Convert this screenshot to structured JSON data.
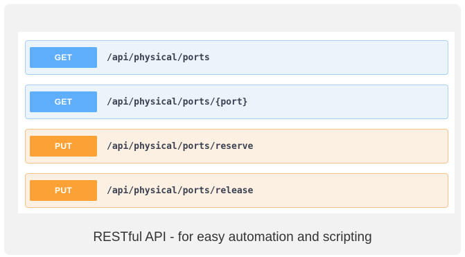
{
  "endpoints": [
    {
      "method": "GET",
      "path": "/api/physical/ports"
    },
    {
      "method": "GET",
      "path": "/api/physical/ports/{port}"
    },
    {
      "method": "PUT",
      "path": "/api/physical/ports/reserve"
    },
    {
      "method": "PUT",
      "path": "/api/physical/ports/release"
    }
  ],
  "caption": "RESTful API - for easy automation and scripting",
  "colors": {
    "get_badge": "#5eaefb",
    "get_row_bg": "#ebf3fb",
    "put_badge": "#fba135",
    "put_row_bg": "#fcf0e3"
  }
}
